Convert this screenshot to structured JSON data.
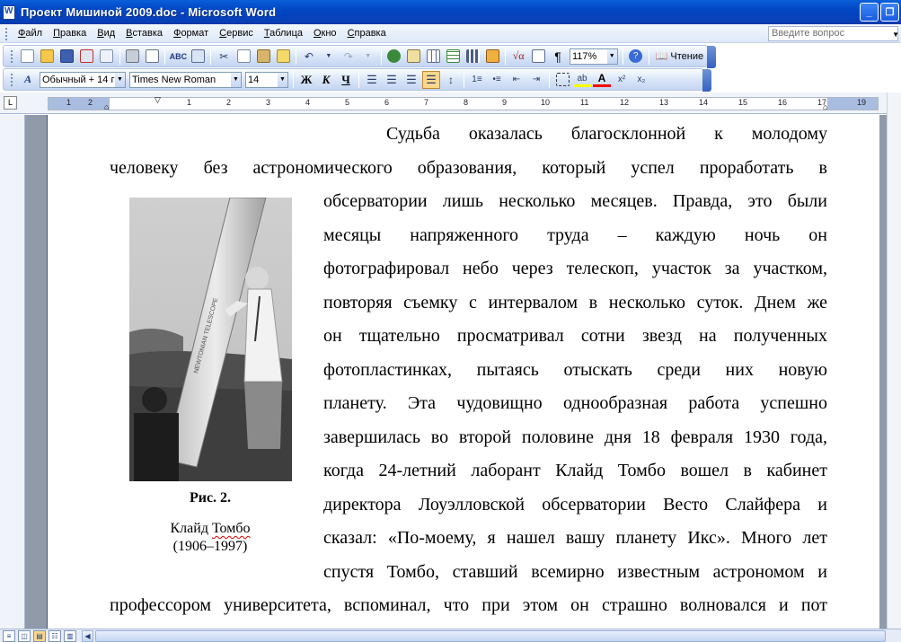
{
  "window": {
    "title": "Проект Мишиной 2009.doc - Microsoft Word"
  },
  "menubar": {
    "items": [
      "Файл",
      "Правка",
      "Вид",
      "Вставка",
      "Формат",
      "Сервис",
      "Таблица",
      "Окно",
      "Справка"
    ],
    "ask_placeholder": "Введите вопрос"
  },
  "standard_toolbar": {
    "zoom": "117%",
    "reading_label": "Чтение"
  },
  "formatting_toolbar": {
    "style": "Обычный + 14 г",
    "font": "Times New Roman",
    "size": "14",
    "bold": "Ж",
    "italic": "К",
    "underline": "Ч"
  },
  "ruler": {
    "numbers": [
      "1",
      "2",
      "1",
      "2",
      "3",
      "4",
      "5",
      "6",
      "7",
      "8",
      "9",
      "10",
      "11",
      "12",
      "13",
      "14",
      "15",
      "16",
      "17",
      "19"
    ]
  },
  "document": {
    "lines": [
      "Судьба оказалась благосклонной к молодому",
      "человеку без астрономического образования, который успел проработать в",
      "обсерватории лишь несколько месяцев. Правда, это были",
      "месяцы напряженного труда – каждую ночь он",
      "фотографировал небо через телескоп, участок за участком,",
      "повторяя съемку с интервалом в несколько суток. Днем же",
      "он тщательно просматривал сотни звезд на полученных",
      "фотопластинках, пытаясь отыскать среди них новую",
      "планету. Эта чудовищно однообразная работа успешно",
      "завершилась во второй половине дня 18 февраля 1930 года,",
      "когда 24-летний лаборант Клайд Томбо вошел в кабинет",
      "директора Лоуэлловской обсерватории Весто Слайфера и",
      "сказал: «По-моему, я нашел вашу планету Икс». Много лет",
      "спустя Томбо, ставший всемирно известным астрономом и",
      "профессором университета, вспоминал, что при этом он страшно волновался и пот"
    ],
    "caption_fig": "Рис. 2.",
    "caption_name_first": "Клайд",
    "caption_name_last": "Томбо",
    "caption_years": "(1906–1997)",
    "photo_telescope_text": "NEWTONIAN TELESCOPE"
  },
  "colors": {
    "titlebar": "#0a4fd0",
    "doc_background": "#919aa9",
    "active_button": "#fbd88a"
  }
}
